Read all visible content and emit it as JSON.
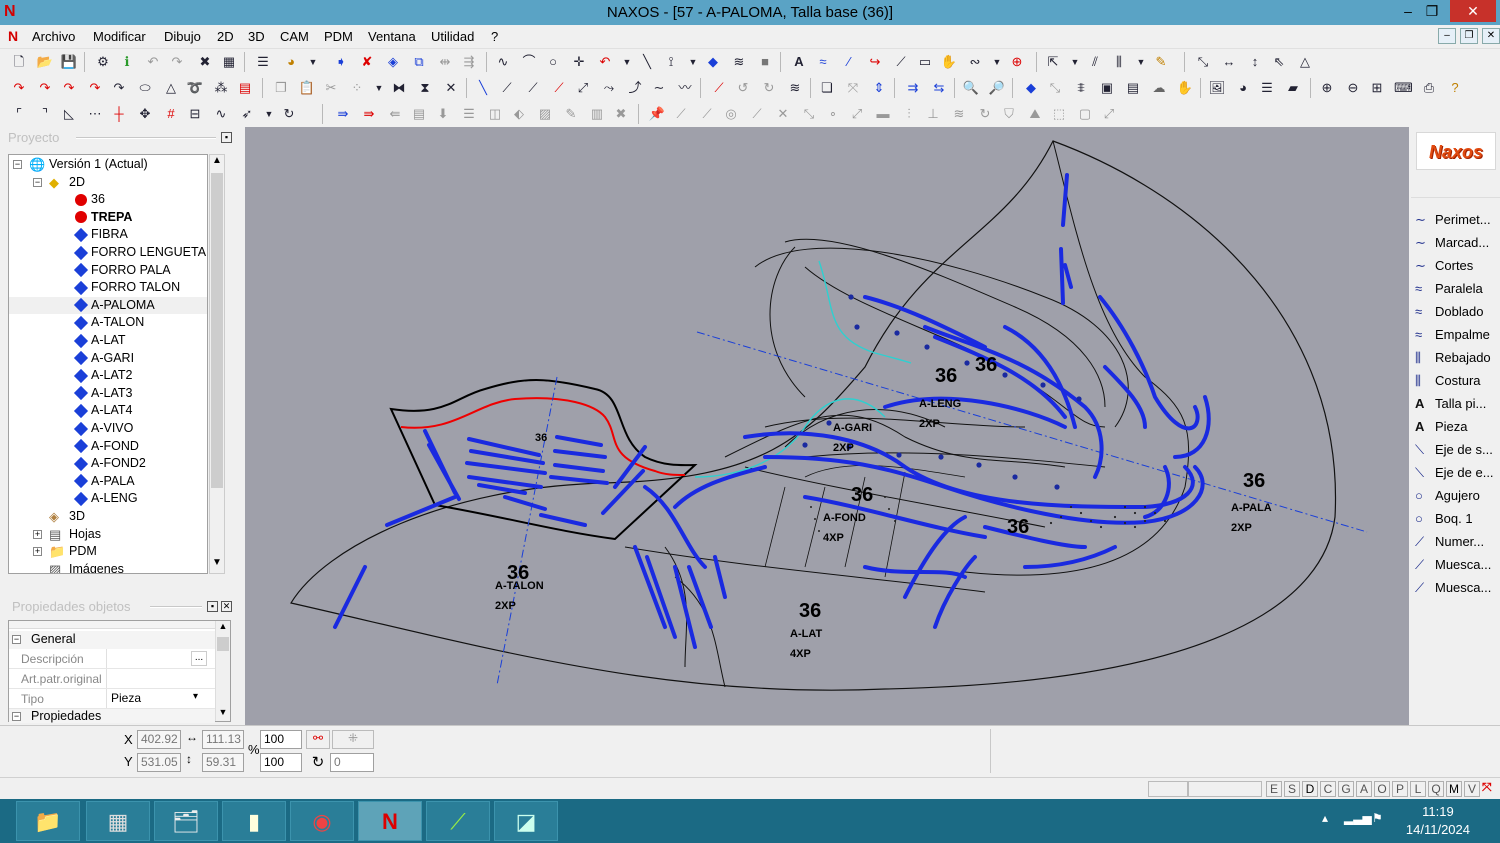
{
  "window": {
    "title": "NAXOS - [57 - A-PALOMA, Talla base (36)]",
    "app_icon": "N",
    "minimize": "–",
    "restore": "❐",
    "close": "✕"
  },
  "menu": [
    "Archivo",
    "Modificar",
    "Dibujo",
    "2D",
    "3D",
    "CAM",
    "PDM",
    "Ventana",
    "Utilidad",
    "?"
  ],
  "project_panel": {
    "title": "Proyecto",
    "tree": [
      {
        "label": "Versión 1 (Actual)",
        "icon": "project-icon",
        "level": 0,
        "expander": "−"
      },
      {
        "label": "2D",
        "icon": "layer-2d-icon",
        "level": 1,
        "expander": "−"
      },
      {
        "label": "36",
        "icon": "red-dot",
        "level": 2
      },
      {
        "label": "TREPA",
        "icon": "red-dot",
        "level": 2,
        "bold": true
      },
      {
        "label": "FIBRA",
        "icon": "blue-diamond",
        "level": 2
      },
      {
        "label": "FORRO LENGUETA",
        "icon": "blue-diamond",
        "level": 2
      },
      {
        "label": "FORRO PALA",
        "icon": "blue-diamond",
        "level": 2
      },
      {
        "label": "FORRO TALON",
        "icon": "blue-diamond",
        "level": 2
      },
      {
        "label": "A-PALOMA",
        "icon": "blue-diamond",
        "level": 2,
        "selected": true
      },
      {
        "label": "A-TALON",
        "icon": "blue-diamond",
        "level": 2
      },
      {
        "label": "A-LAT",
        "icon": "blue-diamond",
        "level": 2
      },
      {
        "label": "A-GARI",
        "icon": "blue-diamond",
        "level": 2
      },
      {
        "label": "A-LAT2",
        "icon": "blue-diamond",
        "level": 2
      },
      {
        "label": "A-LAT3",
        "icon": "blue-diamond",
        "level": 2
      },
      {
        "label": "A-LAT4",
        "icon": "blue-diamond",
        "level": 2
      },
      {
        "label": "A-VIVO",
        "icon": "blue-diamond",
        "level": 2
      },
      {
        "label": "A-FOND",
        "icon": "blue-diamond",
        "level": 2
      },
      {
        "label": "A-FOND2",
        "icon": "blue-diamond",
        "level": 2
      },
      {
        "label": "A-PALA",
        "icon": "blue-diamond",
        "level": 2
      },
      {
        "label": "A-LENG",
        "icon": "blue-diamond",
        "level": 2
      },
      {
        "label": "3D",
        "icon": "layer-3d-icon",
        "level": 1
      },
      {
        "label": "Hojas",
        "icon": "sheets-icon",
        "level": 1,
        "expander": "+"
      },
      {
        "label": "PDM",
        "icon": "folder-icon",
        "level": 1,
        "expander": "+"
      },
      {
        "label": "Imágenes",
        "icon": "images-icon",
        "level": 1
      }
    ]
  },
  "properties_panel": {
    "title": "Propiedades objetos",
    "section_general": "General",
    "rows": [
      {
        "key": "Descripción",
        "value": "",
        "button": "..."
      },
      {
        "key": "Art.patr.original",
        "value": ""
      },
      {
        "key": "Tipo",
        "value": "Pieza",
        "dropdown": "▾"
      }
    ],
    "section_props": "Propiedades"
  },
  "canvas": {
    "labels": [
      {
        "text": "36",
        "sub": "A-TALON",
        "qty": "2XP"
      },
      {
        "text": "36",
        "sub": "A-LAT",
        "qty": "4XP"
      },
      {
        "text": "36",
        "sub": "A-LENG",
        "qty": "2XP"
      },
      {
        "text": "36",
        "sub": "A-PALA",
        "qty": "2XP"
      },
      {
        "text": "36",
        "sub": "A-GARI",
        "qty": "2XP"
      },
      {
        "text": "36",
        "sub": "A-FOND",
        "qty": "4XP"
      },
      {
        "text": "36"
      },
      {
        "text": "36"
      },
      {
        "text": "36"
      }
    ]
  },
  "right_tools": [
    {
      "label": "Perimet...",
      "icon": "perimeter-icon"
    },
    {
      "label": "Marcad...",
      "icon": "marker-icon"
    },
    {
      "label": "Cortes",
      "icon": "cut-icon"
    },
    {
      "label": "Paralela",
      "icon": "parallel-icon"
    },
    {
      "label": "Doblado",
      "icon": "fold-icon"
    },
    {
      "label": "Empalme",
      "icon": "splice-icon"
    },
    {
      "label": "Rebajado",
      "icon": "skive-icon"
    },
    {
      "label": "Costura",
      "icon": "seam-icon"
    },
    {
      "label": "Talla pi...",
      "icon": "size-text-icon"
    },
    {
      "label": "Pieza",
      "icon": "piece-text-icon"
    },
    {
      "label": "Eje de s...",
      "icon": "axis-icon"
    },
    {
      "label": "Eje de e...",
      "icon": "axis-icon"
    },
    {
      "label": "Agujero",
      "icon": "hole-icon"
    },
    {
      "label": "Boq. 1",
      "icon": "punch-icon"
    },
    {
      "label": "Numer...",
      "icon": "number-icon"
    },
    {
      "label": "Muesca...",
      "icon": "notch-icon"
    },
    {
      "label": "Muesca...",
      "icon": "notch-icon"
    }
  ],
  "logo_text": "Naxos",
  "status": {
    "x_label": "X",
    "y_label": "Y",
    "x": "402.92",
    "y": "531.05",
    "w": "111.13",
    "h": "59.31",
    "pct_label": "%",
    "scale_x": "100",
    "scale_y": "100",
    "rotation": "0"
  },
  "mode_keys": [
    "E",
    "S",
    "D",
    "C",
    "G",
    "A",
    "O",
    "P",
    "L",
    "Q",
    "M",
    "V"
  ],
  "taskbar": {
    "time": "11:19",
    "date": "14/11/2024"
  }
}
